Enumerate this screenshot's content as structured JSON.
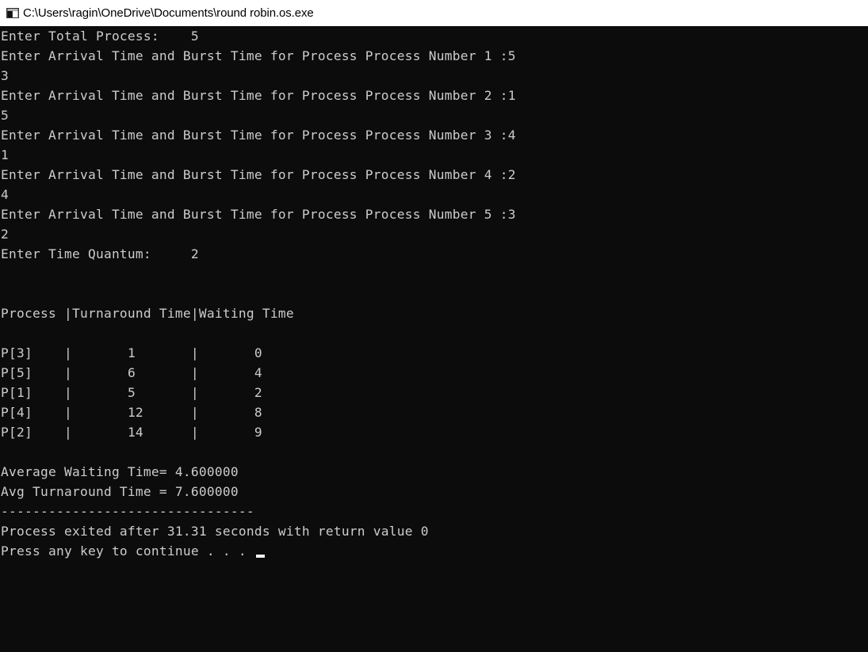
{
  "window": {
    "title": "C:\\Users\\ragin\\OneDrive\\Documents\\round robin.os.exe",
    "icon": "console-app-icon"
  },
  "console": {
    "lines": [
      "Enter Total Process:\t5",
      "Enter Arrival Time and Burst Time for Process Process Number 1 :5",
      "3",
      "Enter Arrival Time and Burst Time for Process Process Number 2 :1",
      "5",
      "Enter Arrival Time and Burst Time for Process Process Number 3 :4",
      "1",
      "Enter Arrival Time and Burst Time for Process Process Number 4 :2",
      "4",
      "Enter Arrival Time and Burst Time for Process Process Number 5 :3",
      "2",
      "Enter Time Quantum:\t2",
      "",
      "",
      "Process |Turnaround Time|Waiting Time",
      "",
      "P[3]\t|\t1\t|\t0",
      "P[5]\t|\t6\t|\t4",
      "P[1]\t|\t5\t|\t2",
      "P[4]\t|\t12\t|\t8",
      "P[2]\t|\t14\t|\t9",
      "",
      "Average Waiting Time= 4.600000",
      "Avg Turnaround Time = 7.600000",
      "--------------------------------",
      "Process exited after 31.31 seconds with return value 0",
      "Press any key to continue . . . "
    ]
  },
  "colors": {
    "background": "#0c0c0c",
    "text": "#cccccc",
    "titlebar": "#ffffff",
    "cursor": "#f2f2f2"
  }
}
